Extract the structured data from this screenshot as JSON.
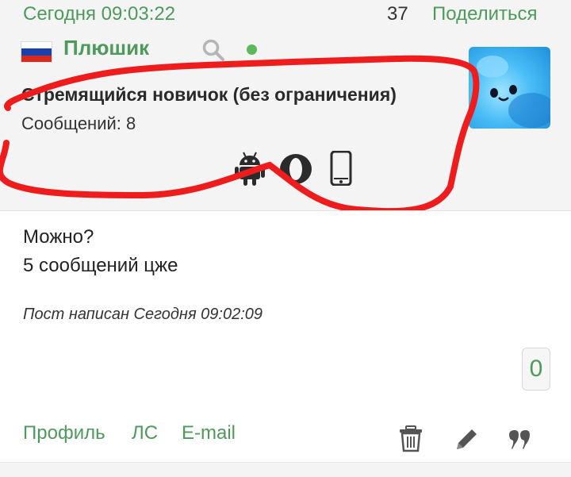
{
  "topbar": {
    "timestamp": "Сегодня 09:03:22",
    "post_number": "37",
    "share_label": "Поделиться"
  },
  "author": {
    "name": "Плюшик",
    "rank": "Стремящийся новичок (без ограничения)",
    "messages_label": "Сообщений:",
    "messages_count": "8",
    "flag": "russia-flag",
    "online": true,
    "devices": [
      "android-icon",
      "opera-icon",
      "mobile-phone-icon"
    ]
  },
  "post": {
    "lines": [
      "Можно?",
      "5 сообщений цже"
    ],
    "meta": "Пост написан Сегодня 09:02:09",
    "votes": "0"
  },
  "footer": {
    "profile_label": "Профиль",
    "pm_label": "ЛС",
    "email_label": "E-mail",
    "actions": [
      "trash-icon",
      "edit-icon",
      "quote-icon"
    ]
  },
  "colors": {
    "accent": "#4d9a5b",
    "annotation": "#ee1c1c"
  }
}
